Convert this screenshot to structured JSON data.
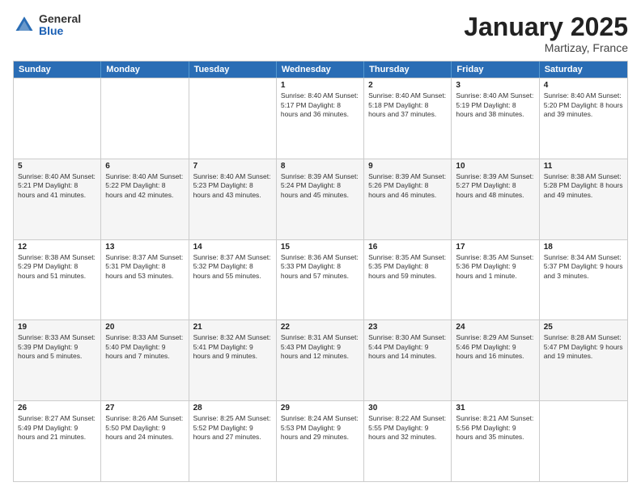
{
  "logo": {
    "general": "General",
    "blue": "Blue"
  },
  "title": "January 2025",
  "location": "Martizay, France",
  "days_of_week": [
    "Sunday",
    "Monday",
    "Tuesday",
    "Wednesday",
    "Thursday",
    "Friday",
    "Saturday"
  ],
  "weeks": [
    [
      {
        "day": "",
        "info": ""
      },
      {
        "day": "",
        "info": ""
      },
      {
        "day": "",
        "info": ""
      },
      {
        "day": "1",
        "info": "Sunrise: 8:40 AM\nSunset: 5:17 PM\nDaylight: 8 hours\nand 36 minutes."
      },
      {
        "day": "2",
        "info": "Sunrise: 8:40 AM\nSunset: 5:18 PM\nDaylight: 8 hours\nand 37 minutes."
      },
      {
        "day": "3",
        "info": "Sunrise: 8:40 AM\nSunset: 5:19 PM\nDaylight: 8 hours\nand 38 minutes."
      },
      {
        "day": "4",
        "info": "Sunrise: 8:40 AM\nSunset: 5:20 PM\nDaylight: 8 hours\nand 39 minutes."
      }
    ],
    [
      {
        "day": "5",
        "info": "Sunrise: 8:40 AM\nSunset: 5:21 PM\nDaylight: 8 hours\nand 41 minutes."
      },
      {
        "day": "6",
        "info": "Sunrise: 8:40 AM\nSunset: 5:22 PM\nDaylight: 8 hours\nand 42 minutes."
      },
      {
        "day": "7",
        "info": "Sunrise: 8:40 AM\nSunset: 5:23 PM\nDaylight: 8 hours\nand 43 minutes."
      },
      {
        "day": "8",
        "info": "Sunrise: 8:39 AM\nSunset: 5:24 PM\nDaylight: 8 hours\nand 45 minutes."
      },
      {
        "day": "9",
        "info": "Sunrise: 8:39 AM\nSunset: 5:26 PM\nDaylight: 8 hours\nand 46 minutes."
      },
      {
        "day": "10",
        "info": "Sunrise: 8:39 AM\nSunset: 5:27 PM\nDaylight: 8 hours\nand 48 minutes."
      },
      {
        "day": "11",
        "info": "Sunrise: 8:38 AM\nSunset: 5:28 PM\nDaylight: 8 hours\nand 49 minutes."
      }
    ],
    [
      {
        "day": "12",
        "info": "Sunrise: 8:38 AM\nSunset: 5:29 PM\nDaylight: 8 hours\nand 51 minutes."
      },
      {
        "day": "13",
        "info": "Sunrise: 8:37 AM\nSunset: 5:31 PM\nDaylight: 8 hours\nand 53 minutes."
      },
      {
        "day": "14",
        "info": "Sunrise: 8:37 AM\nSunset: 5:32 PM\nDaylight: 8 hours\nand 55 minutes."
      },
      {
        "day": "15",
        "info": "Sunrise: 8:36 AM\nSunset: 5:33 PM\nDaylight: 8 hours\nand 57 minutes."
      },
      {
        "day": "16",
        "info": "Sunrise: 8:35 AM\nSunset: 5:35 PM\nDaylight: 8 hours\nand 59 minutes."
      },
      {
        "day": "17",
        "info": "Sunrise: 8:35 AM\nSunset: 5:36 PM\nDaylight: 9 hours\nand 1 minute."
      },
      {
        "day": "18",
        "info": "Sunrise: 8:34 AM\nSunset: 5:37 PM\nDaylight: 9 hours\nand 3 minutes."
      }
    ],
    [
      {
        "day": "19",
        "info": "Sunrise: 8:33 AM\nSunset: 5:39 PM\nDaylight: 9 hours\nand 5 minutes."
      },
      {
        "day": "20",
        "info": "Sunrise: 8:33 AM\nSunset: 5:40 PM\nDaylight: 9 hours\nand 7 minutes."
      },
      {
        "day": "21",
        "info": "Sunrise: 8:32 AM\nSunset: 5:41 PM\nDaylight: 9 hours\nand 9 minutes."
      },
      {
        "day": "22",
        "info": "Sunrise: 8:31 AM\nSunset: 5:43 PM\nDaylight: 9 hours\nand 12 minutes."
      },
      {
        "day": "23",
        "info": "Sunrise: 8:30 AM\nSunset: 5:44 PM\nDaylight: 9 hours\nand 14 minutes."
      },
      {
        "day": "24",
        "info": "Sunrise: 8:29 AM\nSunset: 5:46 PM\nDaylight: 9 hours\nand 16 minutes."
      },
      {
        "day": "25",
        "info": "Sunrise: 8:28 AM\nSunset: 5:47 PM\nDaylight: 9 hours\nand 19 minutes."
      }
    ],
    [
      {
        "day": "26",
        "info": "Sunrise: 8:27 AM\nSunset: 5:49 PM\nDaylight: 9 hours\nand 21 minutes."
      },
      {
        "day": "27",
        "info": "Sunrise: 8:26 AM\nSunset: 5:50 PM\nDaylight: 9 hours\nand 24 minutes."
      },
      {
        "day": "28",
        "info": "Sunrise: 8:25 AM\nSunset: 5:52 PM\nDaylight: 9 hours\nand 27 minutes."
      },
      {
        "day": "29",
        "info": "Sunrise: 8:24 AM\nSunset: 5:53 PM\nDaylight: 9 hours\nand 29 minutes."
      },
      {
        "day": "30",
        "info": "Sunrise: 8:22 AM\nSunset: 5:55 PM\nDaylight: 9 hours\nand 32 minutes."
      },
      {
        "day": "31",
        "info": "Sunrise: 8:21 AM\nSunset: 5:56 PM\nDaylight: 9 hours\nand 35 minutes."
      },
      {
        "day": "",
        "info": ""
      }
    ]
  ]
}
